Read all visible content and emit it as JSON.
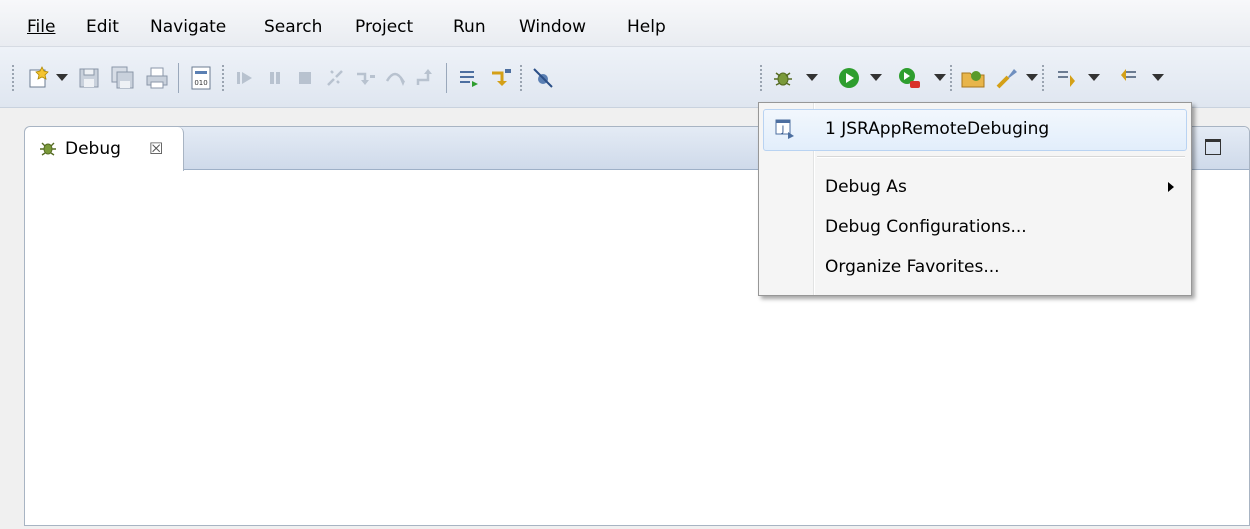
{
  "menubar": {
    "items": [
      {
        "label": "File"
      },
      {
        "label": "Edit"
      },
      {
        "label": "Navigate"
      },
      {
        "label": "Search"
      },
      {
        "label": "Project"
      },
      {
        "label": "Run"
      },
      {
        "label": "Window"
      },
      {
        "label": "Help"
      }
    ]
  },
  "toolbar": {
    "icons": [
      "new-wizard-icon",
      "save-icon",
      "save-all-icon",
      "print-icon",
      "binary-icon",
      "resume-icon",
      "suspend-icon",
      "terminate-icon",
      "disconnect-icon",
      "step-into-icon",
      "step-over-icon",
      "step-return-icon",
      "drop-to-frame-icon",
      "use-step-filters-icon",
      "skip-breakpoints-icon",
      "debug-icon",
      "run-icon",
      "external-tools-icon",
      "open-type-icon",
      "search-icon",
      "next-annotation-icon",
      "previous-annotation-icon"
    ]
  },
  "view": {
    "tab_label": "Debug",
    "close_glyph": "☒"
  },
  "dropdown": {
    "recent_item": "1 JSRAppRemoteDebuging",
    "debug_as": "Debug As",
    "debug_configurations": "Debug Configurations...",
    "organize_favorites": "Organize Favorites..."
  },
  "colors": {
    "accent_green": "#2e9e2e",
    "hover_border": "#b9d3f2",
    "view_border": "#a8b4c3"
  }
}
